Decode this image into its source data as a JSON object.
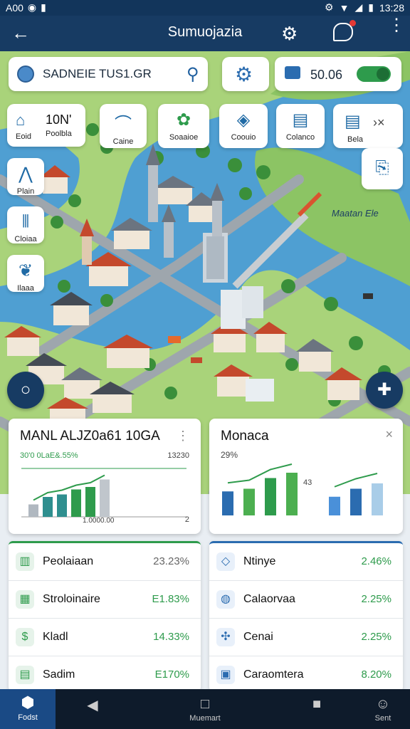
{
  "status_bar": {
    "left": "A00",
    "time": "13:28"
  },
  "app_bar": {
    "title": "Sumuojazia"
  },
  "search": {
    "text": "SADNEIE TUS1.GR"
  },
  "wallet": {
    "value": "50.06"
  },
  "side_tiles": [
    {
      "icon": "house-icon",
      "label": "Eoid",
      "value": "10N'",
      "sub": "Poolbla"
    },
    {
      "icon": "tent-icon",
      "label": "Plain"
    },
    {
      "icon": "tools-icon",
      "label": "Cloiaa"
    },
    {
      "icon": "leaf-icon",
      "label": "Ilaaa"
    }
  ],
  "top_tiles": [
    {
      "icon": "arch-icon",
      "label": "Caine"
    },
    {
      "icon": "gear-leaf-icon",
      "label": "Soaaioe"
    },
    {
      "icon": "drop-icon",
      "label": "Coouio"
    },
    {
      "icon": "clipboard-icon",
      "label": "Colanco"
    },
    {
      "icon": "clipboard-icon",
      "label": "Bela"
    }
  ],
  "map_label": "Maatan Ele",
  "panel_left": {
    "title": "MANL ALJZ0a61 10GA",
    "left_label": "30'0 0LaE&.55%",
    "right_label": "13230",
    "bottom_label": "1.0000.00",
    "corner": "2",
    "chart_data": {
      "type": "bar",
      "values": [
        25,
        40,
        45,
        55,
        60,
        75
      ]
    }
  },
  "panel_right": {
    "title": "Monaca",
    "pct": "29%",
    "side_value": "43",
    "chart_data": {
      "type": "bar",
      "values": [
        45,
        50,
        70,
        80,
        35,
        50,
        60
      ]
    }
  },
  "list_left": [
    {
      "name": "Peolaiaan",
      "value": "23.23%",
      "color": "#666666",
      "icon": "chart-icon"
    },
    {
      "name": "Stroloinaire",
      "value": "E1.83%",
      "color": "#2e9b4c",
      "icon": "table-icon"
    },
    {
      "name": "Kladl",
      "value": "14.33%",
      "color": "#2e9b4c",
      "icon": "dollar-icon"
    },
    {
      "name": "Sadim",
      "value": "E170%",
      "color": "#2e9b4c",
      "icon": "ledger-icon"
    }
  ],
  "list_right": [
    {
      "name": "Ntinye",
      "value": "2.46%",
      "color": "#2e9b4c",
      "icon": "diamond-icon"
    },
    {
      "name": "Calaorvaa",
      "value": "2.25%",
      "color": "#2e9b4c",
      "icon": "shield-icon"
    },
    {
      "name": "Cenai",
      "value": "2.25%",
      "color": "#2e9b4c",
      "icon": "network-icon"
    },
    {
      "name": "Caraomtera",
      "value": "8.20%",
      "color": "#2e9b4c",
      "icon": "grid-icon"
    }
  ],
  "bottom_nav": {
    "home": "Fodst",
    "center": "Muemart",
    "right": "Sent"
  }
}
